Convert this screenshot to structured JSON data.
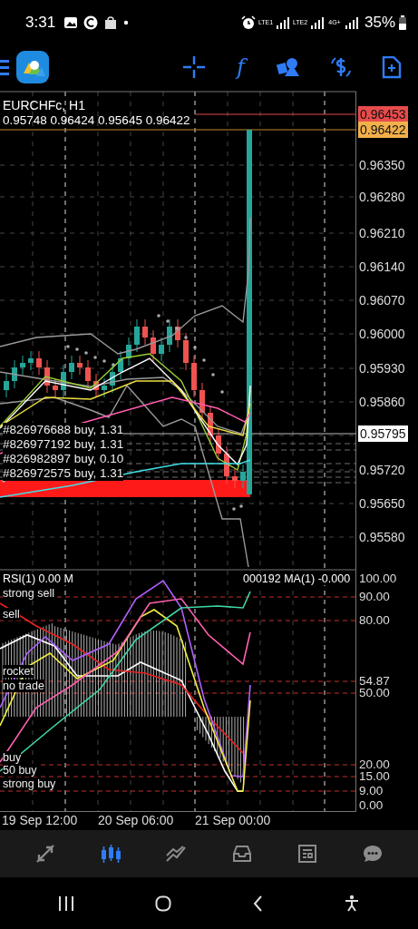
{
  "status_bar": {
    "time": "3:31",
    "network_labels": [
      "LTE1",
      "LTE2",
      "4G+"
    ],
    "battery": "35%"
  },
  "toolbar": {
    "indicator_glyph": "f"
  },
  "chart": {
    "symbol": "EURCHFc, H1",
    "ohlc": "0.95748 0.96424 0.95645 0.96422",
    "price_ticks": [
      "0.96350",
      "0.96280",
      "0.96210",
      "0.96140",
      "0.96070",
      "0.96000",
      "0.95930",
      "0.95860",
      "0.95720",
      "0.95650",
      "0.95580"
    ],
    "price_markers": [
      {
        "kind": "ask",
        "text": "0.96453"
      },
      {
        "kind": "bid",
        "text": "0.96422"
      },
      {
        "kind": "line",
        "text": "0.95795"
      }
    ],
    "orders": [
      "#826976688 buy, 1.31",
      "#826977192 buy, 1.31",
      "#826982897 buy, 0.10",
      "#826972575 buy, 1.31"
    ],
    "rsi": {
      "header_left": "RSI(1) 0.00 M",
      "header_right": "000192 MA(1) -0.000",
      "zone_labels": [
        "strong sell",
        "sell",
        "rocket",
        "no trade",
        "buy",
        "50 buy",
        "strong buy"
      ],
      "level_ticks": [
        "100.00",
        "90.00",
        "80.00",
        "54.87",
        "50.00",
        "20.00",
        "15.00",
        "9.00",
        "0.00"
      ]
    },
    "time_labels": [
      "19 Sep 12:00",
      "20 Sep 06:00",
      "21 Sep 00:00"
    ]
  },
  "bottom_nav": [
    {
      "kind": "quotes",
      "selected": false
    },
    {
      "kind": "chart",
      "selected": true
    },
    {
      "kind": "trade",
      "selected": false
    },
    {
      "kind": "history",
      "selected": false
    },
    {
      "kind": "news",
      "selected": false
    },
    {
      "kind": "chat",
      "selected": false
    }
  ]
}
